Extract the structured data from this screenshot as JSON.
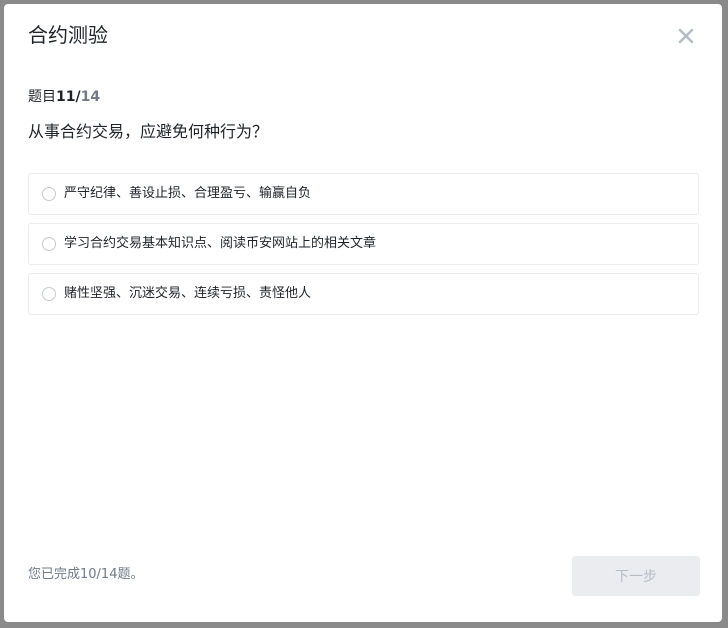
{
  "dialog": {
    "title": "合约测验",
    "close_icon": "close-icon"
  },
  "progress": {
    "prefix": "题目",
    "current": "11",
    "separator": "/",
    "total": "14"
  },
  "question": {
    "text": "从事合约交易，应避免何种行为？",
    "options": [
      {
        "label": "严守纪律、善设止损、合理盈亏、输赢自负"
      },
      {
        "label": "学习合约交易基本知识点、阅读币安网站上的相关文章"
      },
      {
        "label": "赌性坚强、沉迷交易、连续亏损、责怪他人"
      }
    ]
  },
  "footer": {
    "status": "您已完成10/14题。",
    "next_label": "下一步"
  }
}
